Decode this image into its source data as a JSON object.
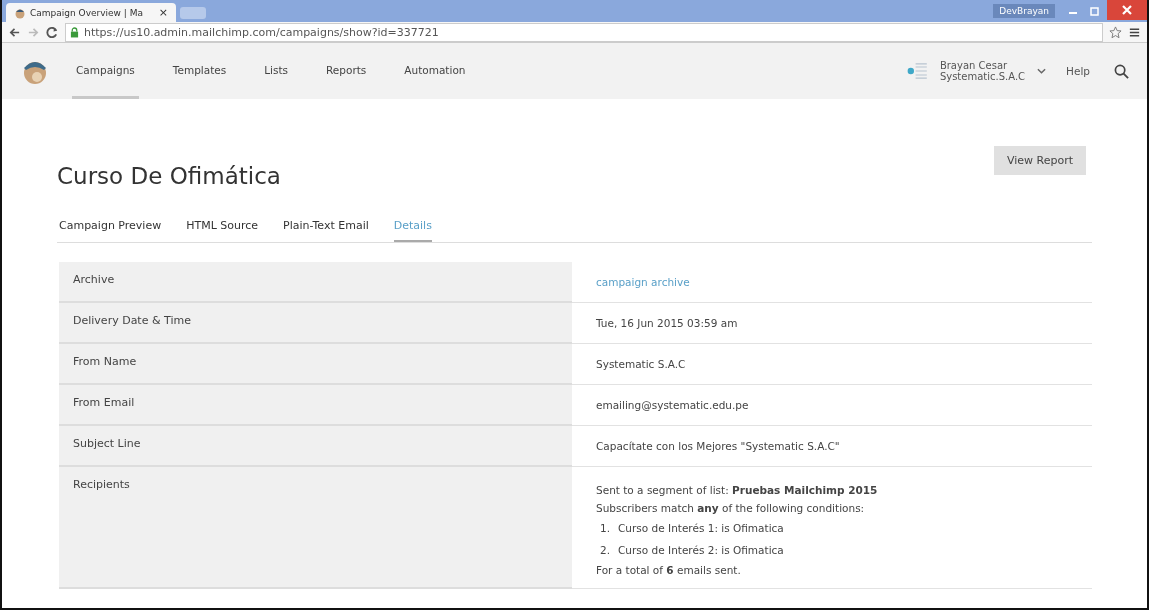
{
  "browser": {
    "tab_title": "Campaign Overview | Ma",
    "tab_close": "×",
    "user_badge": "DevBrayan",
    "url": "https://us10.admin.mailchimp.com/campaigns/show?id=337721"
  },
  "nav": {
    "items": [
      {
        "label": "Campaigns",
        "selected": true
      },
      {
        "label": "Templates",
        "selected": false
      },
      {
        "label": "Lists",
        "selected": false
      },
      {
        "label": "Reports",
        "selected": false
      },
      {
        "label": "Automation",
        "selected": false
      }
    ],
    "user_name": "Brayan Cesar",
    "user_company": "Systematic.S.A.C",
    "help": "Help"
  },
  "page": {
    "title": "Curso De Ofimática",
    "view_report": "View Report",
    "tabs": [
      {
        "label": "Campaign Preview",
        "selected": false
      },
      {
        "label": "HTML Source",
        "selected": false
      },
      {
        "label": "Plain-Text Email",
        "selected": false
      },
      {
        "label": "Details",
        "selected": true
      }
    ],
    "details": [
      {
        "label": "Archive",
        "kind": "link",
        "value": "campaign archive"
      },
      {
        "label": "Delivery Date & Time",
        "kind": "text",
        "value": "Tue, 16 Jun 2015 03:59 am"
      },
      {
        "label": "From Name",
        "kind": "text",
        "value": "Systematic S.A.C"
      },
      {
        "label": "From Email",
        "kind": "text",
        "value": "emailing@systematic.edu.pe"
      },
      {
        "label": "Subject Line",
        "kind": "text",
        "value": "Capacítate con los Mejores \"Systematic S.A.C\""
      },
      {
        "label": "Recipients",
        "kind": "recipients",
        "lines": [
          "Sent to a segment of list: **Pruebas Mailchimp 2015**",
          "Subscribers match **any** of the following conditions:"
        ],
        "conditions": [
          {
            "number": "1.",
            "text": "Curso de Interés 1: is Ofimatica"
          },
          {
            "number": "2.",
            "text": "Curso de Interés 2: is Ofimatica"
          }
        ],
        "total": "For a total of **6** emails sent."
      }
    ]
  }
}
